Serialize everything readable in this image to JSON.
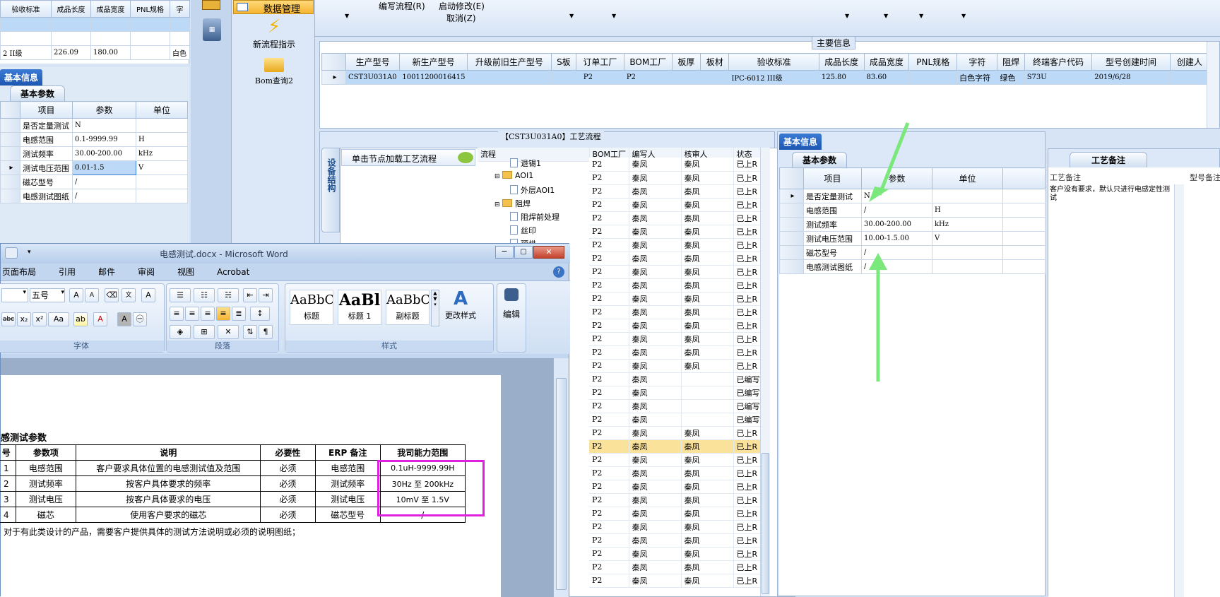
{
  "top_left_partial": {
    "headers": [
      "验收标准",
      "成品长度",
      "成品宽度",
      "PNL规格",
      "字"
    ],
    "row": [
      "2 II级",
      "226.09",
      "180.00",
      "",
      "白色"
    ]
  },
  "left_panel": {
    "tab": "基本信息",
    "subtab": "基本参数",
    "headers": [
      "项目",
      "参数",
      "单位"
    ],
    "rows": [
      {
        "item": "是否定量测试",
        "param": "N",
        "unit": ""
      },
      {
        "item": "电感范围",
        "param": "0.1-9999.99",
        "unit": "H"
      },
      {
        "item": "测试频率",
        "param": "30.00-200.00",
        "unit": "kHz"
      },
      {
        "item": "测试电压范围",
        "param": "0.01-1.5",
        "unit": "V"
      },
      {
        "item": "磁芯型号",
        "param": "/",
        "unit": ""
      },
      {
        "item": "电感测试图纸",
        "param": "/",
        "unit": ""
      }
    ]
  },
  "toolbar": {
    "data_mgmt": "数据管理",
    "new_flow": "新流程指示",
    "bom_query": "Bom查询2",
    "edit_flow": "编写流程(R)",
    "start_modify": "启动修改(E)",
    "cancel": "取消(Z)"
  },
  "main_info": {
    "title": "主要信息",
    "headers": [
      "生产型号",
      "新生产型号",
      "升级前旧生产型号",
      "S板",
      "订单工厂",
      "BOM工厂",
      "板厚",
      "板材",
      "验收标准",
      "成品长度",
      "成品宽度",
      "PNL规格",
      "字符",
      "阻焊",
      "终端客户代码",
      "型号创建时间",
      "创建人"
    ],
    "row": [
      "CST3U031A0",
      "10011200016415",
      "",
      "",
      "P2",
      "P2",
      "",
      "",
      "IPC-6012 III级",
      "125.80",
      "83.60",
      "",
      "白色字符",
      "绿色",
      "S73U",
      "2019/6/28",
      ""
    ]
  },
  "process_flow": {
    "title": "【CST3U031A0】工艺流程",
    "side_tab": "设备结构",
    "load_btn": "单击节点加载工艺流程",
    "headers": [
      "流程",
      "BOM工厂",
      "编写人",
      "核审人",
      "状态"
    ],
    "tree": [
      "退锡1",
      "AOI1",
      "外层AOI1",
      "阻焊",
      "阻焊前处理",
      "丝印",
      "预烘"
    ],
    "rows": [
      {
        "bom": "P2",
        "writer": "秦凤",
        "auditor": "秦凤",
        "status": "已上R"
      },
      {
        "bom": "P2",
        "writer": "秦凤",
        "auditor": "秦凤",
        "status": "已上R"
      },
      {
        "bom": "P2",
        "writer": "秦凤",
        "auditor": "秦凤",
        "status": "已上R"
      },
      {
        "bom": "P2",
        "writer": "秦凤",
        "auditor": "秦凤",
        "status": "已上R"
      },
      {
        "bom": "P2",
        "writer": "秦凤",
        "auditor": "秦凤",
        "status": "已上R"
      },
      {
        "bom": "P2",
        "writer": "秦凤",
        "auditor": "秦凤",
        "status": "已上R"
      },
      {
        "bom": "P2",
        "writer": "秦凤",
        "auditor": "秦凤",
        "status": "已上R"
      },
      {
        "bom": "P2",
        "writer": "秦凤",
        "auditor": "秦凤",
        "status": "已上R"
      },
      {
        "bom": "P2",
        "writer": "秦凤",
        "auditor": "秦凤",
        "status": "已上R"
      },
      {
        "bom": "P2",
        "writer": "秦凤",
        "auditor": "秦凤",
        "status": "已上R"
      },
      {
        "bom": "P2",
        "writer": "秦凤",
        "auditor": "秦凤",
        "status": "已上R"
      },
      {
        "bom": "P2",
        "writer": "秦凤",
        "auditor": "秦凤",
        "status": "已上R"
      },
      {
        "bom": "P2",
        "writer": "秦凤",
        "auditor": "秦凤",
        "status": "已上R"
      },
      {
        "bom": "P2",
        "writer": "秦凤",
        "auditor": "秦凤",
        "status": "已上R"
      },
      {
        "bom": "P2",
        "writer": "秦凤",
        "auditor": "秦凤",
        "status": "已上R"
      },
      {
        "bom": "P2",
        "writer": "秦凤",
        "auditor": "秦凤",
        "status": "已上R"
      },
      {
        "bom": "P2",
        "writer": "秦凤",
        "auditor": "",
        "status": "已编写"
      },
      {
        "bom": "P2",
        "writer": "秦凤",
        "auditor": "",
        "status": "已编写"
      },
      {
        "bom": "P2",
        "writer": "秦凤",
        "auditor": "",
        "status": "已编写"
      },
      {
        "bom": "P2",
        "writer": "秦凤",
        "auditor": "",
        "status": "已编写"
      },
      {
        "bom": "P2",
        "writer": "秦凤",
        "auditor": "秦凤",
        "status": "已上R"
      },
      {
        "bom": "P2",
        "writer": "秦凤",
        "auditor": "秦凤",
        "status": "已上R"
      },
      {
        "bom": "P2",
        "writer": "秦凤",
        "auditor": "秦凤",
        "status": "已上R"
      },
      {
        "bom": "P2",
        "writer": "秦凤",
        "auditor": "秦凤",
        "status": "已上R"
      },
      {
        "bom": "P2",
        "writer": "秦凤",
        "auditor": "秦凤",
        "status": "已上R"
      },
      {
        "bom": "P2",
        "writer": "秦凤",
        "auditor": "秦凤",
        "status": "已上R"
      },
      {
        "bom": "P2",
        "writer": "秦凤",
        "auditor": "秦凤",
        "status": "已上R"
      },
      {
        "bom": "P2",
        "writer": "秦凤",
        "auditor": "秦凤",
        "status": "已上R"
      },
      {
        "bom": "P2",
        "writer": "秦凤",
        "auditor": "秦凤",
        "status": "已上R"
      },
      {
        "bom": "P2",
        "writer": "秦凤",
        "auditor": "秦凤",
        "status": "已上R"
      },
      {
        "bom": "P2",
        "writer": "秦凤",
        "auditor": "秦凤",
        "status": "已上R"
      },
      {
        "bom": "P2",
        "writer": "秦凤",
        "auditor": "秦凤",
        "status": "已上R"
      }
    ]
  },
  "right_panel": {
    "tab": "基本信息",
    "subtab": "基本参数",
    "headers": [
      "项目",
      "参数",
      "单位"
    ],
    "rows": [
      {
        "item": "是否定量测试",
        "param": "N",
        "unit": ""
      },
      {
        "item": "电感范围",
        "param": "/",
        "unit": "H"
      },
      {
        "item": "测试频率",
        "param": "30.00-200.00",
        "unit": "kHz"
      },
      {
        "item": "测试电压范围",
        "param": "10.00-1.5.00",
        "unit": "V"
      },
      {
        "item": "磁芯型号",
        "param": "/",
        "unit": ""
      },
      {
        "item": "电感测试图纸",
        "param": "/",
        "unit": ""
      }
    ],
    "note_tab": "工艺备注",
    "note_header": "工艺备注",
    "note_header2": "型号备注",
    "note_text": "客户没有要求，默认只进行电感定性测试"
  },
  "word": {
    "title": "电感测试.docx - Microsoft Word",
    "tabs": [
      "页面布局",
      "引用",
      "邮件",
      "审阅",
      "视图",
      "Acrobat"
    ],
    "font_size": "五号",
    "group_font": "字体",
    "group_para": "段落",
    "group_style": "样式",
    "styles": [
      {
        "preview": "AaBbC",
        "name": "标题"
      },
      {
        "preview": "AaBl",
        "name": "标题 1"
      },
      {
        "preview": "AaBbC",
        "name": "副标题"
      }
    ],
    "change_style": "更改样式",
    "edit": "编辑",
    "doc_heading": "感测试参数",
    "table_headers": [
      "号",
      "参数项",
      "说明",
      "必要性",
      "ERP 备注",
      "我司能力范围"
    ],
    "table_rows": [
      [
        "1",
        "电感范围",
        "客户要求具体位置的电感测试值及范围",
        "必须",
        "电感范围",
        "0.1uH-9999.99H"
      ],
      [
        "2",
        "测试频率",
        "按客户具体要求的频率",
        "必须",
        "测试频率",
        "30Hz 至 200kHz"
      ],
      [
        "3",
        "测试电压",
        "按客户具体要求的电压",
        "必须",
        "测试电压",
        "10mV 至 1.5V"
      ],
      [
        "4",
        "磁芯",
        "使用客户要求的磁芯",
        "必须",
        "磁芯型号",
        "/"
      ]
    ],
    "footer_note": "对于有此类设计的产品，需要客户提供具体的测试方法说明或必须的说明图纸；"
  }
}
